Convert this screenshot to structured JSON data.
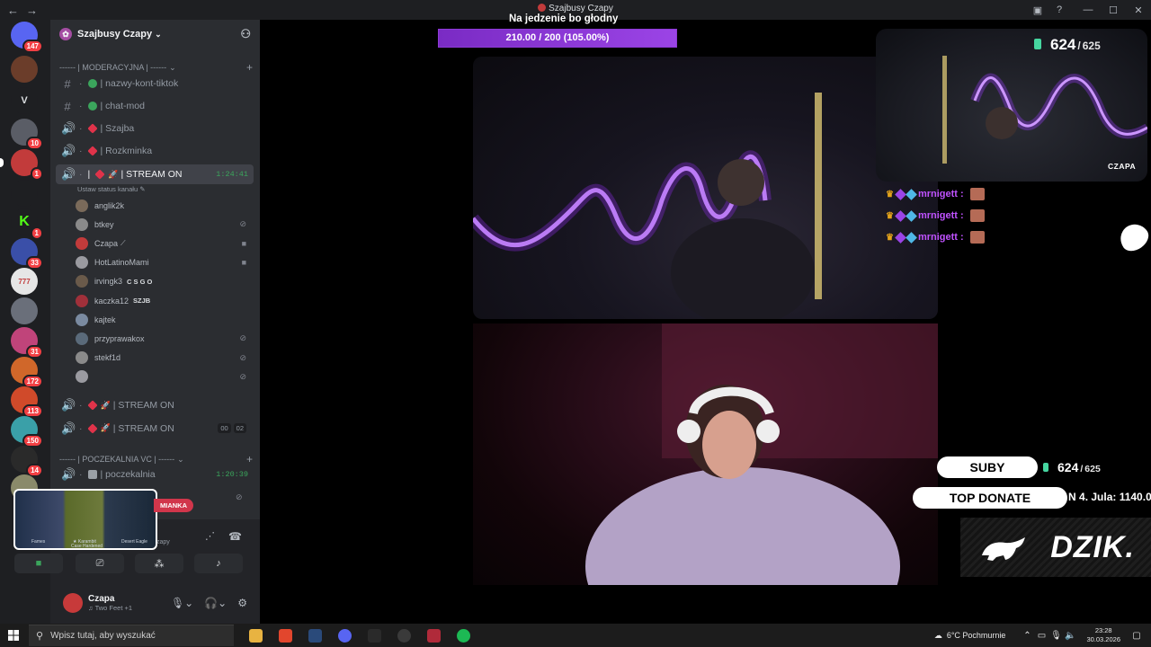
{
  "window": {
    "title": "Szajbusy Czapy",
    "nav": {
      "back": "←",
      "forward": "→"
    },
    "controls": {
      "minimize": "—",
      "maximize": "☐",
      "close": "✕"
    }
  },
  "server_rail": [
    {
      "name": "direct-messages",
      "label": "",
      "color": "#5865f2",
      "badge": "147",
      "selected": false
    },
    {
      "name": "server-1",
      "label": "",
      "color": "#6b3d2a",
      "badge": "",
      "selected": false
    },
    {
      "name": "server-v",
      "label": "V",
      "color": "#1e1f22",
      "badge": "",
      "selected": false
    },
    {
      "name": "server-3",
      "label": "",
      "color": "#5a5d66",
      "badge": "10",
      "selected": false
    },
    {
      "name": "server-szajbusy",
      "label": "",
      "color": "#c23b3b",
      "badge": "1",
      "selected": true
    },
    {
      "name": "server-5",
      "label": "",
      "color": "#1e1f22",
      "badge": "",
      "selected": false
    },
    {
      "name": "server-kick",
      "label": "K",
      "color": "#1e1f22",
      "badge": "1",
      "selected": false
    },
    {
      "name": "server-7",
      "label": "",
      "color": "#3a4fa8",
      "badge": "33",
      "selected": false
    },
    {
      "name": "server-777",
      "label": "777",
      "color": "#e6e6e6",
      "badge": "",
      "selected": false
    },
    {
      "name": "server-9",
      "label": "",
      "color": "#6a6f7a",
      "badge": "",
      "selected": false
    },
    {
      "name": "server-10",
      "label": "",
      "color": "#c0447a",
      "badge": "31",
      "selected": false
    },
    {
      "name": "server-11",
      "label": "",
      "color": "#d0672a",
      "badge": "172",
      "selected": false
    },
    {
      "name": "server-12",
      "label": "",
      "color": "#d04a2a",
      "badge": "113",
      "selected": false
    },
    {
      "name": "server-13",
      "label": "",
      "color": "#3aa0a8",
      "badge": "150",
      "selected": false
    },
    {
      "name": "server-14",
      "label": "",
      "color": "#2a2a2a",
      "badge": "14",
      "selected": false
    },
    {
      "name": "server-15",
      "label": "",
      "color": "#8a8a6a",
      "badge": "",
      "selected": false
    }
  ],
  "sidebar": {
    "guild_name": "Szajbusy Czapy",
    "categories": {
      "moderation": "------ | MODERACYJNA | ------",
      "waiting": "------ | POCZEKALNIA VC | ------"
    },
    "channels": [
      {
        "label": "| nazwy-kont-tiktok",
        "type": "text",
        "emoji_color": "#3ba55c",
        "time": "",
        "active": false
      },
      {
        "label": "| chat-mod",
        "type": "text",
        "emoji_color": "#3ba55c",
        "time": "",
        "active": false
      },
      {
        "label": "| Szajba",
        "type": "voice",
        "emoji_color": "#e0334a",
        "time": "",
        "active": false
      },
      {
        "label": "| Rozkminka",
        "type": "voice",
        "emoji_color": "#e0334a",
        "time": "",
        "active": false
      },
      {
        "label": "| STREAM ON",
        "type": "voice",
        "emoji_color": "#e0334a",
        "time": "1:24:41",
        "active": true
      }
    ],
    "channel_status": "Ustaw status kanału",
    "voice_users": [
      {
        "name": "anglik2k",
        "icon": "",
        "chip": "",
        "avatar": "#7a6a5a"
      },
      {
        "name": "btkey",
        "icon": "deafened-icon",
        "chip": "",
        "avatar": "#8a8a8a"
      },
      {
        "name": "Czapa",
        "icon": "camera-icon",
        "chip": "",
        "avatar": "#c23b3b"
      },
      {
        "name": "HotLatinoMami",
        "icon": "camera-icon",
        "chip": "",
        "avatar": "#9a9aa0"
      },
      {
        "name": "irvingk3",
        "icon": "",
        "chip": "C S G O",
        "avatar": "#6a5a4a"
      },
      {
        "name": "kaczka12",
        "icon": "",
        "chip": "SZJB",
        "avatar": "#a0303a"
      },
      {
        "name": "kajtek",
        "icon": "",
        "chip": "",
        "avatar": "#7a8aa0"
      },
      {
        "name": "przyprawakox",
        "icon": "deafened-icon",
        "chip": "",
        "avatar": "#5a6a7a"
      },
      {
        "name": "stekf1d",
        "icon": "deafened-icon",
        "chip": "",
        "avatar": "#8a8a8a"
      },
      {
        "name": "",
        "icon": "deafened-icon",
        "chip": "",
        "avatar": "#9a9aa0"
      }
    ],
    "more_channels": [
      {
        "label": "| STREAM ON",
        "type": "voice",
        "emoji_color": "#e0334a",
        "time": "",
        "counts": [
          "",
          ""
        ]
      },
      {
        "label": "| STREAM ON",
        "type": "voice",
        "emoji_color": "#e0334a",
        "time": "",
        "counts": [
          "00",
          "02"
        ]
      }
    ],
    "waiting_channel": {
      "label": "| poczekalnia",
      "time": "1:20:39"
    },
    "popup": {
      "item1": "Fames",
      "item2": "★ Karambit",
      "item2_sub": "Case Hardened",
      "item3": "Desert Eagle"
    },
    "badge": "MIANKA",
    "user": {
      "name": "Czapa",
      "status": "Two Feet +1"
    }
  },
  "stream": {
    "goal_title": "Na jedzenie bo głodny",
    "goal_text": "210.00 / 200 (105.00%)",
    "goal_progress": 1.0,
    "sub_count": "624",
    "sub_goal": "625",
    "corner_label": "CZAPA",
    "chat_name": "mrnigett :",
    "chat_rows": 3,
    "suby_label": "SUBY",
    "top_donate_label": "TOP DONATE",
    "top_donate_value": "4. Jula: 1140.0",
    "top_donate_prefix": "N",
    "brand": "DZIK."
  },
  "taskbar": {
    "search_placeholder": "Wpisz tutaj, aby wyszukać",
    "weather": "6°C  Pochmurnie",
    "time": "23:28",
    "date": "30.03.2026",
    "apps": [
      {
        "name": "file-explorer",
        "color": "#e8b341"
      },
      {
        "name": "brave-browser",
        "color": "#e2462d"
      },
      {
        "name": "steam",
        "color": "#2a4a7a"
      },
      {
        "name": "discord",
        "color": "#5865f2"
      },
      {
        "name": "epic-games",
        "color": "#2a2a2a"
      },
      {
        "name": "obs",
        "color": "#3a3a3a"
      },
      {
        "name": "affinity",
        "color": "#b02a3a"
      },
      {
        "name": "spotify",
        "color": "#1db954"
      }
    ]
  }
}
